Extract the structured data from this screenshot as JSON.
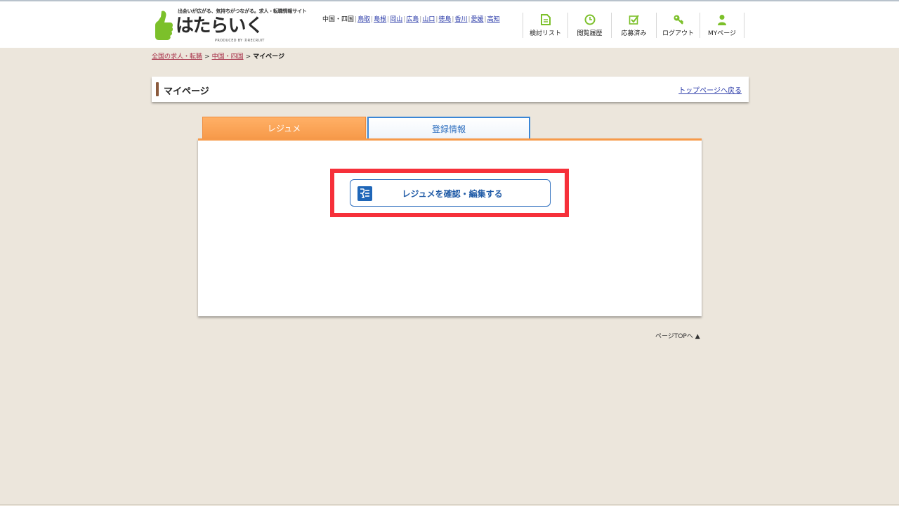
{
  "header": {
    "tagline": "出会いが広がる、気持ちがつながる。求人・転職情報サイト",
    "brand": "はたらいく",
    "produced_by": "PRODUCED BY ⓇRECRUIT"
  },
  "region_nav": {
    "label": "中国・四国",
    "links": [
      "鳥取",
      "島根",
      "岡山",
      "広島",
      "山口",
      "徳島",
      "香川",
      "愛媛",
      "高知"
    ]
  },
  "util_nav": [
    {
      "label": "検討リスト",
      "icon": "document-icon"
    },
    {
      "label": "閲覧履歴",
      "icon": "clock-icon"
    },
    {
      "label": "応募済み",
      "icon": "checkbox-icon"
    },
    {
      "label": "ログアウト",
      "icon": "key-icon"
    },
    {
      "label": "MYページ",
      "icon": "person-icon"
    }
  ],
  "breadcrumb": {
    "items": [
      "全国の求人・転職",
      "中国・四国"
    ],
    "current": "マイページ"
  },
  "page": {
    "title": "マイページ",
    "top_link": "トップページへ戻る"
  },
  "tabs": [
    {
      "label": "レジュメ",
      "active": true
    },
    {
      "label": "登録情報",
      "active": false
    }
  ],
  "resume_button": {
    "label": "レジュメを確認・編集する"
  },
  "page_top": "ページTOPへ ▲",
  "colors": {
    "accent_orange": "#f79a4a",
    "link_blue": "#2a3aa8",
    "button_blue": "#2f6fbf",
    "icon_green": "#7cc02a",
    "highlight_red": "#f6303a",
    "background": "#ece6dc"
  }
}
